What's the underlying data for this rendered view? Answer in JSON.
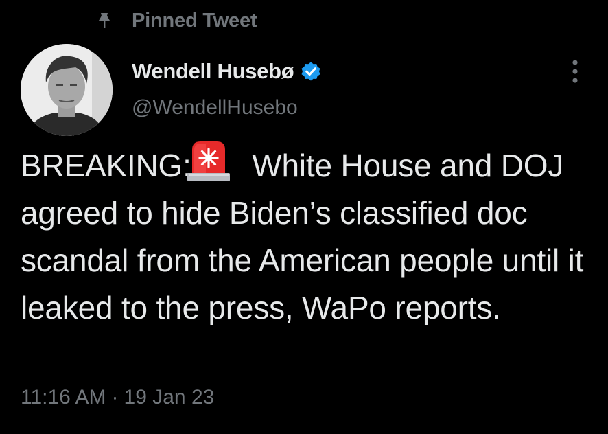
{
  "pinned": {
    "label": "Pinned Tweet",
    "icon": "pin-icon"
  },
  "author": {
    "display_name": "Wendell Husebø",
    "handle": "@WendellHusebo",
    "verified_icon": "verified-badge-icon",
    "verified_color": "#1d9bf0"
  },
  "tweet": {
    "text_before_emoji": "BREAKING:",
    "emoji_icon": "police-siren-icon",
    "text_after_emoji": " White House and DOJ agreed to hide Biden’s classified doc scandal from the American people until it leaked to the press, WaPo reports."
  },
  "meta": {
    "time": "11:16 AM",
    "separator": "·",
    "date": "19 Jan 23"
  },
  "menu": {
    "icon": "more-options-icon"
  },
  "colors": {
    "background": "#000000",
    "primary_text": "#e7e9ea",
    "secondary_text": "#71767b",
    "accent": "#1d9bf0"
  }
}
